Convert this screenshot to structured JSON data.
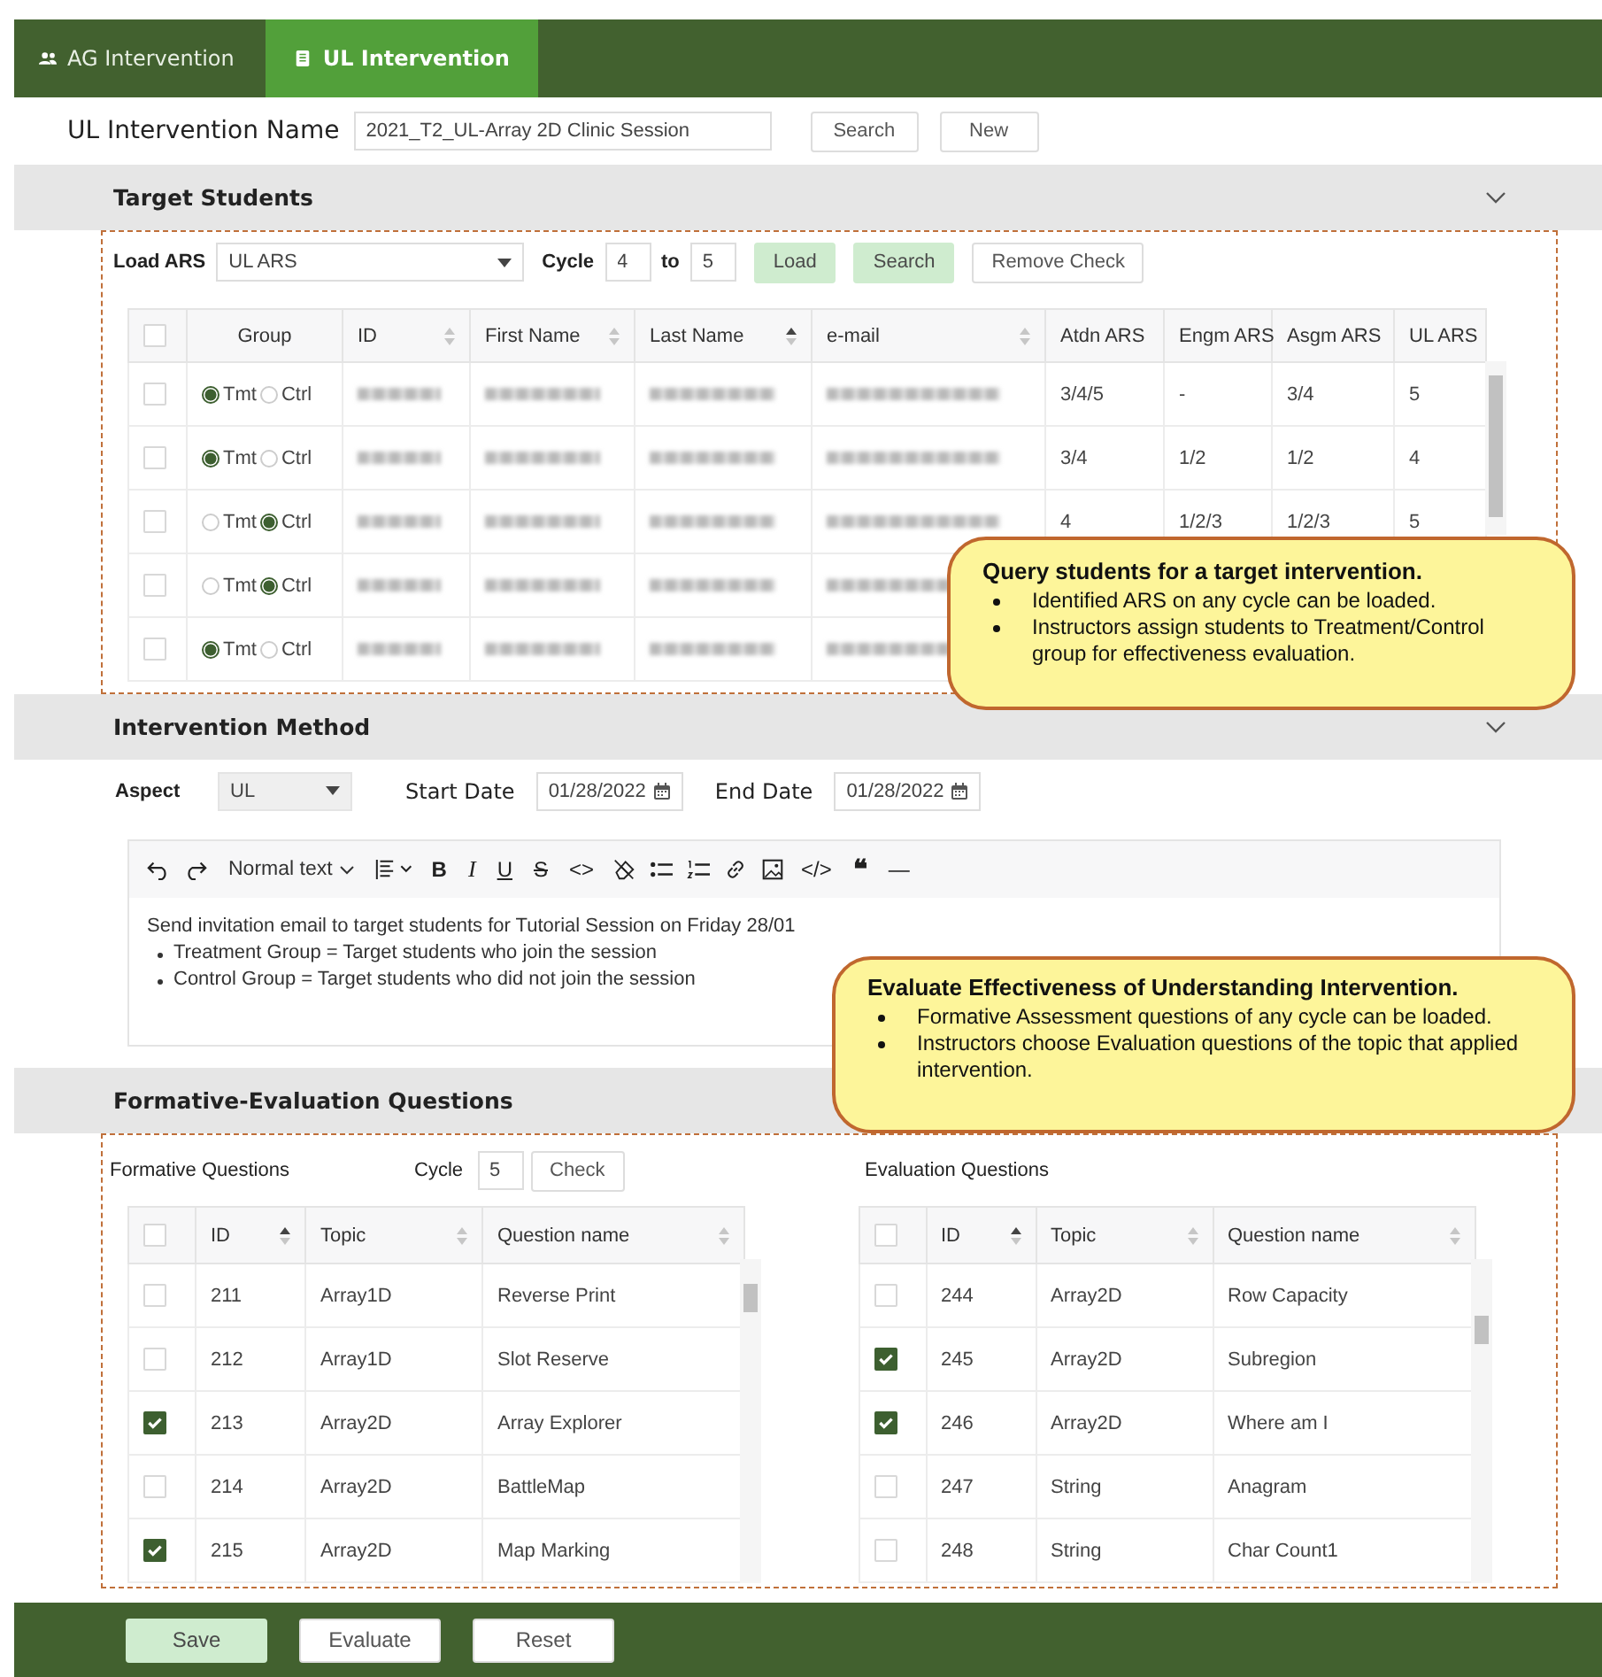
{
  "tabs": [
    {
      "label": "AG Intervention",
      "selected": false
    },
    {
      "label": "UL Intervention",
      "selected": true
    }
  ],
  "name_row": {
    "label": "UL Intervention Name",
    "value": "2021_T2_UL-Array 2D Clinic Session",
    "buttons": [
      {
        "label": "Search",
        "kind": "default"
      },
      {
        "label": "New",
        "kind": "default"
      }
    ]
  },
  "target_students": {
    "title": "Target Students",
    "expanded": true,
    "load_label": "Load ARS",
    "ars_select": "UL ARS",
    "cycle_label": "Cycle",
    "cycle_from": "4",
    "to_label": "to",
    "cycle_to": "5",
    "buttons": [
      {
        "label": "Load",
        "kind": "primary"
      },
      {
        "label": "Search",
        "kind": "primary"
      },
      {
        "label": "Remove Check",
        "kind": "default"
      }
    ],
    "header_checked": false,
    "columns": [
      {
        "kind": "check"
      },
      {
        "kind": "group",
        "label": "Group"
      },
      {
        "kind": "blurred",
        "label": "ID",
        "sortable": true,
        "sorted": false
      },
      {
        "kind": "blurred",
        "label": "First Name",
        "sortable": true,
        "sorted": false
      },
      {
        "kind": "blurred",
        "label": "Last Name",
        "sortable": true,
        "sorted": true
      },
      {
        "kind": "blurred",
        "label": "e-mail",
        "sortable": true,
        "sorted": false
      },
      {
        "kind": "value",
        "label": "Atdn ARS"
      },
      {
        "kind": "value",
        "label": "Engm ARS"
      },
      {
        "kind": "value",
        "label": "Asgm ARS"
      },
      {
        "kind": "value",
        "label": "UL ARS"
      }
    ],
    "rows": [
      {
        "checked": false,
        "radios": [
          {
            "label": "Tmt",
            "selected": true
          },
          {
            "label": "Ctrl",
            "selected": false
          }
        ],
        "values": [
          "3/4/5",
          "-",
          "3/4",
          "5"
        ]
      },
      {
        "checked": false,
        "radios": [
          {
            "label": "Tmt",
            "selected": true
          },
          {
            "label": "Ctrl",
            "selected": false
          }
        ],
        "values": [
          "3/4",
          "1/2",
          "1/2",
          "4"
        ]
      },
      {
        "checked": false,
        "radios": [
          {
            "label": "Tmt",
            "selected": false
          },
          {
            "label": "Ctrl",
            "selected": true
          }
        ],
        "values": [
          "4",
          "1/2/3",
          "1/2/3",
          "5"
        ]
      },
      {
        "checked": false,
        "radios": [
          {
            "label": "Tmt",
            "selected": false
          },
          {
            "label": "Ctrl",
            "selected": true
          }
        ]
      },
      {
        "checked": false,
        "radios": [
          {
            "label": "Tmt",
            "selected": true
          },
          {
            "label": "Ctrl",
            "selected": false
          }
        ]
      }
    ]
  },
  "intervention_method": {
    "title": "Intervention Method",
    "expanded": true,
    "aspect_label": "Aspect",
    "aspect": "UL",
    "start_label": "Start Date",
    "start_date": "01/28/2022",
    "end_label": "End Date",
    "end_date": "01/28/2022",
    "toolbar": [
      {
        "kind": "undo"
      },
      {
        "kind": "redo"
      },
      {
        "kind": "menu",
        "label": "Normal text"
      },
      {
        "kind": "align"
      },
      {
        "kind": "bold",
        "label": "B"
      },
      {
        "kind": "italic",
        "label": "I"
      },
      {
        "kind": "underline",
        "label": "U"
      },
      {
        "kind": "strike",
        "label": "S"
      },
      {
        "kind": "code",
        "label": "<>"
      },
      {
        "kind": "clear"
      },
      {
        "kind": "bullets"
      },
      {
        "kind": "numbers"
      },
      {
        "kind": "link"
      },
      {
        "kind": "image"
      },
      {
        "kind": "code",
        "label": "</>"
      },
      {
        "kind": "quote",
        "label": "❝"
      },
      {
        "kind": "code",
        "label": "—"
      }
    ],
    "content": {
      "line": "Send invitation email to target students for Tutorial Session on Friday 28/01",
      "bullets": [
        "Treatment Group = Target students who join the session",
        "Control Group = Target students who did not join the session"
      ]
    }
  },
  "formative_evaluation": {
    "title": "Formative-Evaluation Questions",
    "formative": {
      "title": "Formative Questions",
      "cycle_label": "Cycle",
      "cycle": "5",
      "button": "Check",
      "header_checked": false,
      "columns": [
        {
          "label": "ID",
          "sortable": true,
          "sorted": true
        },
        {
          "label": "Topic",
          "sortable": true,
          "sorted": false
        },
        {
          "label": "Question name",
          "sortable": true,
          "sorted": false
        }
      ],
      "rows": [
        {
          "checked": false,
          "cells": [
            "211",
            "Array1D",
            "Reverse Print"
          ]
        },
        {
          "checked": false,
          "cells": [
            "212",
            "Array1D",
            "Slot Reserve"
          ]
        },
        {
          "checked": true,
          "cells": [
            "213",
            "Array2D",
            "Array Explorer"
          ]
        },
        {
          "checked": false,
          "cells": [
            "214",
            "Array2D",
            "BattleMap"
          ]
        },
        {
          "checked": true,
          "cells": [
            "215",
            "Array2D",
            "Map Marking"
          ]
        }
      ]
    },
    "evaluation": {
      "title": "Evaluation Questions",
      "header_checked": false,
      "columns": [
        {
          "label": "ID",
          "sortable": true,
          "sorted": true
        },
        {
          "label": "Topic",
          "sortable": true,
          "sorted": false
        },
        {
          "label": "Question name",
          "sortable": true,
          "sorted": false
        }
      ],
      "rows": [
        {
          "checked": false,
          "cells": [
            "244",
            "Array2D",
            "Row Capacity"
          ]
        },
        {
          "checked": true,
          "cells": [
            "245",
            "Array2D",
            "Subregion"
          ]
        },
        {
          "checked": true,
          "cells": [
            "246",
            "Array2D",
            "Where am I"
          ]
        },
        {
          "checked": false,
          "cells": [
            "247",
            "String",
            "Anagram"
          ]
        },
        {
          "checked": false,
          "cells": [
            "248",
            "String",
            "Char Count1"
          ]
        }
      ]
    }
  },
  "footer_buttons": [
    {
      "label": "Save",
      "kind": "primary"
    },
    {
      "label": "Evaluate",
      "kind": "default"
    },
    {
      "label": "Reset",
      "kind": "default"
    }
  ],
  "callouts": [
    {
      "title": "Query students for a target intervention.",
      "bullets": [
        "Identified ARS on any cycle can be loaded.",
        "Instructors assign students to Treatment/Control group for effectiveness evaluation."
      ]
    },
    {
      "title": "Evaluate Effectiveness of Understanding Intervention.",
      "bullets": [
        "Formative Assessment questions of any cycle can be loaded.",
        "Instructors choose Evaluation questions of the topic that applied intervention."
      ]
    }
  ]
}
